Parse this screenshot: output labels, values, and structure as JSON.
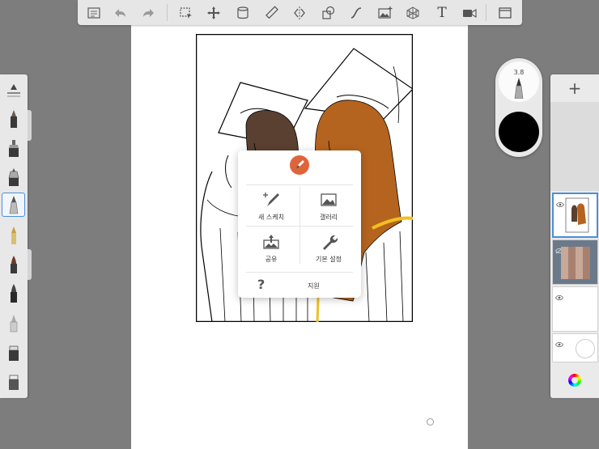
{
  "toolbar": {
    "items": [
      "list-icon",
      "undo-icon",
      "redo-icon",
      "selection-icon",
      "transform-icon",
      "fill-icon",
      "ruler-icon",
      "symmetry-icon",
      "shape-icon",
      "stroke-icon",
      "image-icon",
      "perspective-icon",
      "text-icon",
      "video-icon",
      "fullscreen-icon"
    ],
    "text_tool_label": "T"
  },
  "puck": {
    "brush_size": "3.8",
    "color": "#000000"
  },
  "layers": {
    "add_label": "+"
  },
  "menu": {
    "new_sketch": "새 스케치",
    "gallery": "갤러리",
    "share": "공유",
    "preferences": "기본 설정",
    "help": "지원",
    "help_icon": "?"
  },
  "colors": {
    "accent": "#4a90d9",
    "logo": "#e0643a",
    "hair_brown": "#b5641f",
    "hair_dark": "#5a4030",
    "gold": "#f0c020"
  }
}
